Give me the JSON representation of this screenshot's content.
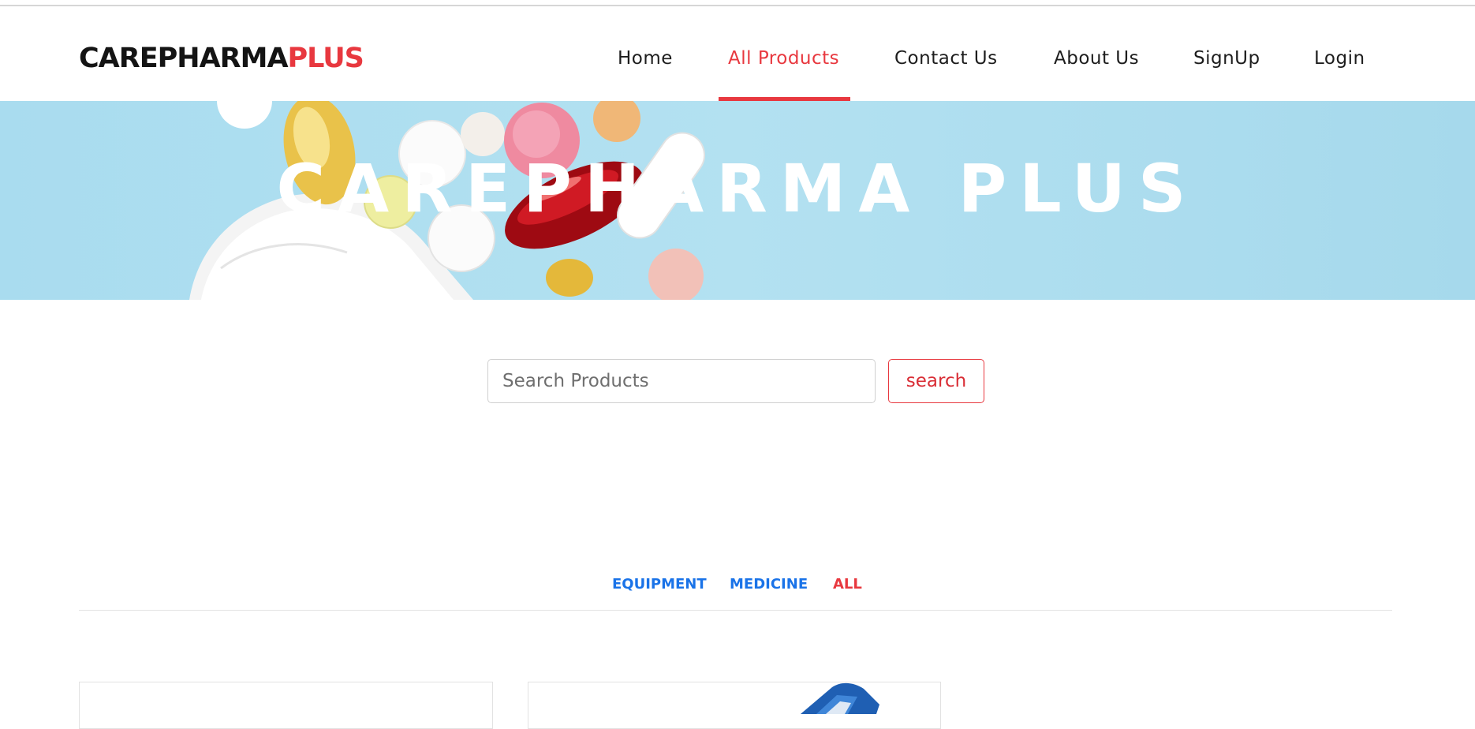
{
  "brand": {
    "part1": "CAREPHARMA",
    "part2": "PLUS"
  },
  "nav": {
    "items": [
      {
        "label": "Home",
        "active": false
      },
      {
        "label": "All Products",
        "active": true
      },
      {
        "label": "Contact Us",
        "active": false
      },
      {
        "label": "About Us",
        "active": false
      },
      {
        "label": "SignUp",
        "active": false
      },
      {
        "label": "Login",
        "active": false
      }
    ]
  },
  "hero": {
    "title": "CAREPHARMA PLUS"
  },
  "search": {
    "placeholder": "Search Products",
    "value": "",
    "button_label": "search"
  },
  "filters": {
    "items": [
      {
        "label": "EQUIPMENT",
        "active": false
      },
      {
        "label": "MEDICINE",
        "active": false
      },
      {
        "label": "ALL",
        "active": true
      }
    ]
  },
  "colors": {
    "accent": "#e8383f",
    "link_blue": "#1a73e8",
    "text_dark": "#141414",
    "hero_bg": "#b3e1f1"
  },
  "icons": [
    "pills-image",
    "product-thumbnail"
  ]
}
